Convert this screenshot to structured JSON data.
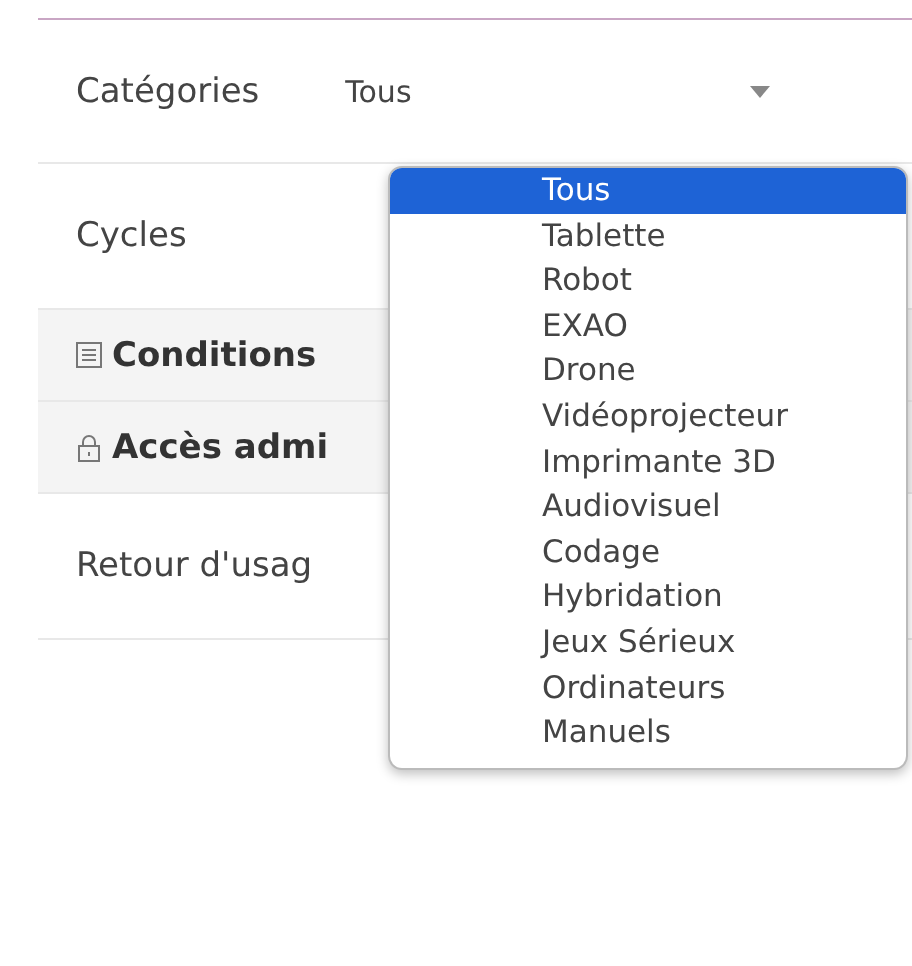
{
  "filters": [
    {
      "label": "Catégories",
      "value": "Tous"
    },
    {
      "label": "Cycles"
    }
  ],
  "sections": [
    {
      "label": "Conditions",
      "kind": "terms"
    },
    {
      "label": "Accès admi",
      "kind": "admin"
    }
  ],
  "feedback": {
    "label": "Retour d'usag"
  },
  "dropdown": {
    "options": [
      {
        "label": "Tous",
        "selected": true
      },
      {
        "label": "Tablette",
        "selected": false
      },
      {
        "label": "Robot",
        "selected": false
      },
      {
        "label": "EXAO",
        "selected": false
      },
      {
        "label": "Drone",
        "selected": false
      },
      {
        "label": "Vidéoprojecteur",
        "selected": false
      },
      {
        "label": "Imprimante 3D",
        "selected": false
      },
      {
        "label": "Audiovisuel",
        "selected": false
      },
      {
        "label": "Codage",
        "selected": false
      },
      {
        "label": "Hybridation",
        "selected": false
      },
      {
        "label": "Jeux Sérieux",
        "selected": false
      },
      {
        "label": "Ordinateurs",
        "selected": false
      },
      {
        "label": "Manuels",
        "selected": false
      }
    ]
  }
}
